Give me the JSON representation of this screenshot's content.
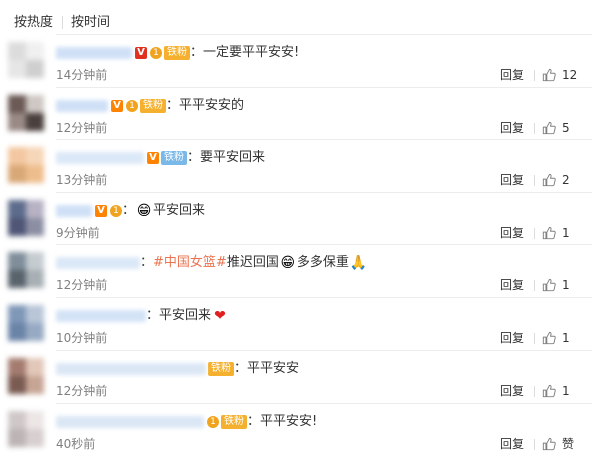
{
  "sort": {
    "hot": "按热度",
    "time": "按时间"
  },
  "ui": {
    "colon": "：",
    "reply": "回复"
  },
  "colors": {
    "topic": "#eb7350",
    "fan_badge": "#f5b02f",
    "fan_badge_blue": "#7ab8e8",
    "v_badge": "#ff8200"
  },
  "comments": [
    {
      "text_parts": [
        {
          "text": "一定要平平安安!"
        }
      ],
      "time": "14分钟前",
      "likes": "12",
      "badges": {
        "v": "V",
        "level": "1",
        "fan": "铁粉"
      }
    },
    {
      "text_parts": [
        {
          "text": "平平安安的"
        }
      ],
      "time": "12分钟前",
      "likes": "5",
      "badges": {
        "v": "V",
        "level": "1",
        "fan": "铁粉"
      }
    },
    {
      "text_parts": [
        {
          "text": "要平安回来"
        }
      ],
      "time": "13分钟前",
      "likes": "2",
      "badges": {
        "v": "V",
        "fan": "铁粉"
      }
    },
    {
      "text_parts": [
        {
          "emoji": "smile-emoji",
          "glyph": "😁"
        },
        {
          "text": "平安回来"
        }
      ],
      "time": "9分钟前",
      "likes": "1",
      "badges": {
        "v": "V",
        "level": "1"
      }
    },
    {
      "text_parts": [
        {
          "topic": "#中国女篮#"
        },
        {
          "text": "推迟回国"
        },
        {
          "emoji": "grin-emoji",
          "glyph": "😁"
        },
        {
          "text": "多多保重"
        },
        {
          "emoji": "pray-emoji",
          "glyph": "🙏"
        }
      ],
      "time": "12分钟前",
      "likes": "1",
      "badges": {}
    },
    {
      "text_parts": [
        {
          "text": "平安回来"
        },
        {
          "emoji": "heart-emoji",
          "glyph": "❤"
        }
      ],
      "time": "10分钟前",
      "likes": "1",
      "badges": {}
    },
    {
      "text_parts": [
        {
          "text": "平平安安"
        }
      ],
      "time": "12分钟前",
      "likes": "1",
      "badges": {
        "fan": "铁粉"
      }
    },
    {
      "text_parts": [
        {
          "text": "平平安安!"
        }
      ],
      "time": "40秒前",
      "likes": "赞",
      "badges": {
        "level": "1",
        "fan": "铁粉"
      }
    }
  ]
}
